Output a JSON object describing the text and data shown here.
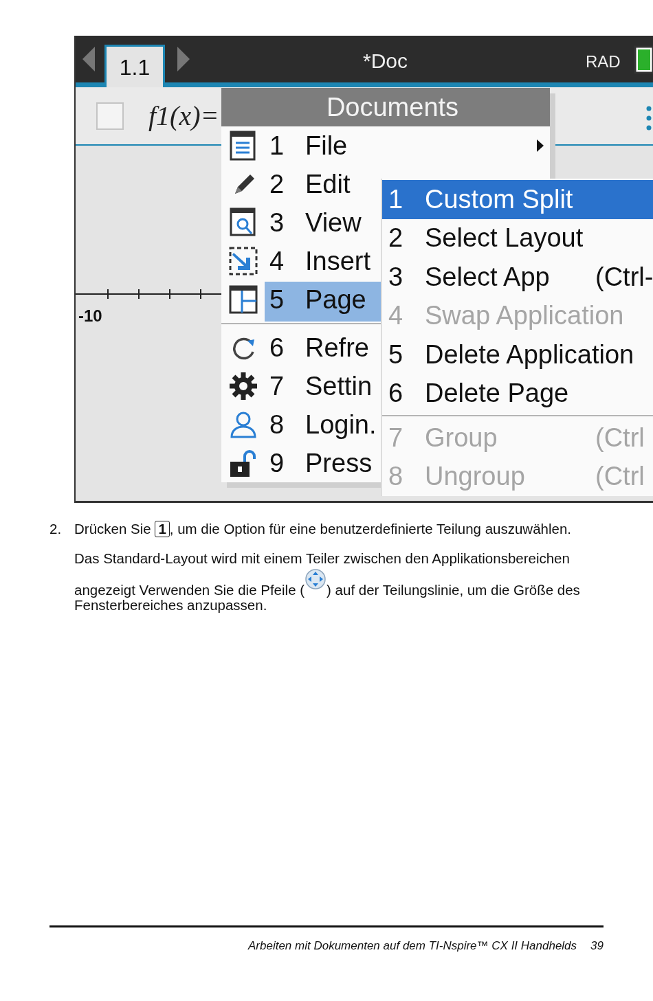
{
  "device": {
    "tab": "1.1",
    "title": "*Doc",
    "mode": "RAD",
    "entry_label": "f1(x)=",
    "checkbox_checked": false,
    "axis_label": "-10"
  },
  "menu": {
    "title": "Documents",
    "sections": [
      [
        {
          "number": "1",
          "label": "File",
          "has_submenu": true,
          "selected": false
        },
        {
          "number": "2",
          "label": "Edit",
          "selected": false
        },
        {
          "number": "3",
          "label": "View",
          "selected": false
        },
        {
          "number": "4",
          "label": "Insert",
          "selected": false
        },
        {
          "number": "5",
          "label": "Page",
          "selected": true
        }
      ],
      [
        {
          "number": "6",
          "label": "Refre",
          "selected": false
        },
        {
          "number": "7",
          "label": "Settin",
          "selected": false
        },
        {
          "number": "8",
          "label": "Login.",
          "selected": false
        },
        {
          "number": "9",
          "label": "Press",
          "selected": false
        }
      ]
    ]
  },
  "submenu": {
    "sections": [
      [
        {
          "number": "1",
          "label": "Custom Split",
          "selected": true,
          "disabled": false
        },
        {
          "number": "2",
          "label": "Select Layout",
          "selected": false,
          "disabled": false
        },
        {
          "number": "3",
          "label": "Select App",
          "shortcut": "(Ctrl-",
          "selected": false,
          "disabled": false
        },
        {
          "number": "4",
          "label": "Swap Application",
          "selected": false,
          "disabled": true
        },
        {
          "number": "5",
          "label": "Delete Application",
          "selected": false,
          "disabled": false
        },
        {
          "number": "6",
          "label": "Delete Page",
          "selected": false,
          "disabled": false
        }
      ],
      [
        {
          "number": "7",
          "label": "Group",
          "shortcut": "(Ctrl",
          "selected": false,
          "disabled": true
        },
        {
          "number": "8",
          "label": "Ungroup",
          "shortcut": "(Ctrl",
          "selected": false,
          "disabled": true
        }
      ]
    ]
  },
  "step": {
    "number": "2.",
    "text_before": "Drücken Sie",
    "key": "1",
    "text_after": ", um die Option für eine benutzerdefinierte Teilung auszuwählen."
  },
  "note": {
    "line_1": "Das Standard-Layout wird mit einem Teiler zwischen den Applikationsbereichen",
    "line_2_before": "angezeigt Verwenden Sie die Pfeile (",
    "line_2_after": ") auf der Teilungslinie, um die Größe des",
    "line_3": "Fensterbereiches anzupassen."
  },
  "footer": {
    "title": "Arbeiten mit Dokumenten auf dem TI-Nspire™ CX II Handhelds",
    "page": "39"
  }
}
